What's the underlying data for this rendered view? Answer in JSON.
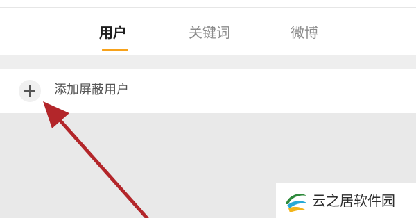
{
  "tabs": [
    {
      "label": "用户",
      "active": true
    },
    {
      "label": "关键词",
      "active": false
    },
    {
      "label": "微博",
      "active": false
    }
  ],
  "add_user": {
    "label": "添加屏蔽用户",
    "icon": "plus-icon"
  },
  "watermark": {
    "text": "云之居软件园",
    "icon": "leaf-swirl-logo-icon"
  },
  "colors": {
    "accent": "#f7a21b",
    "arrow": "#b3262a",
    "background": "#ebebeb"
  }
}
